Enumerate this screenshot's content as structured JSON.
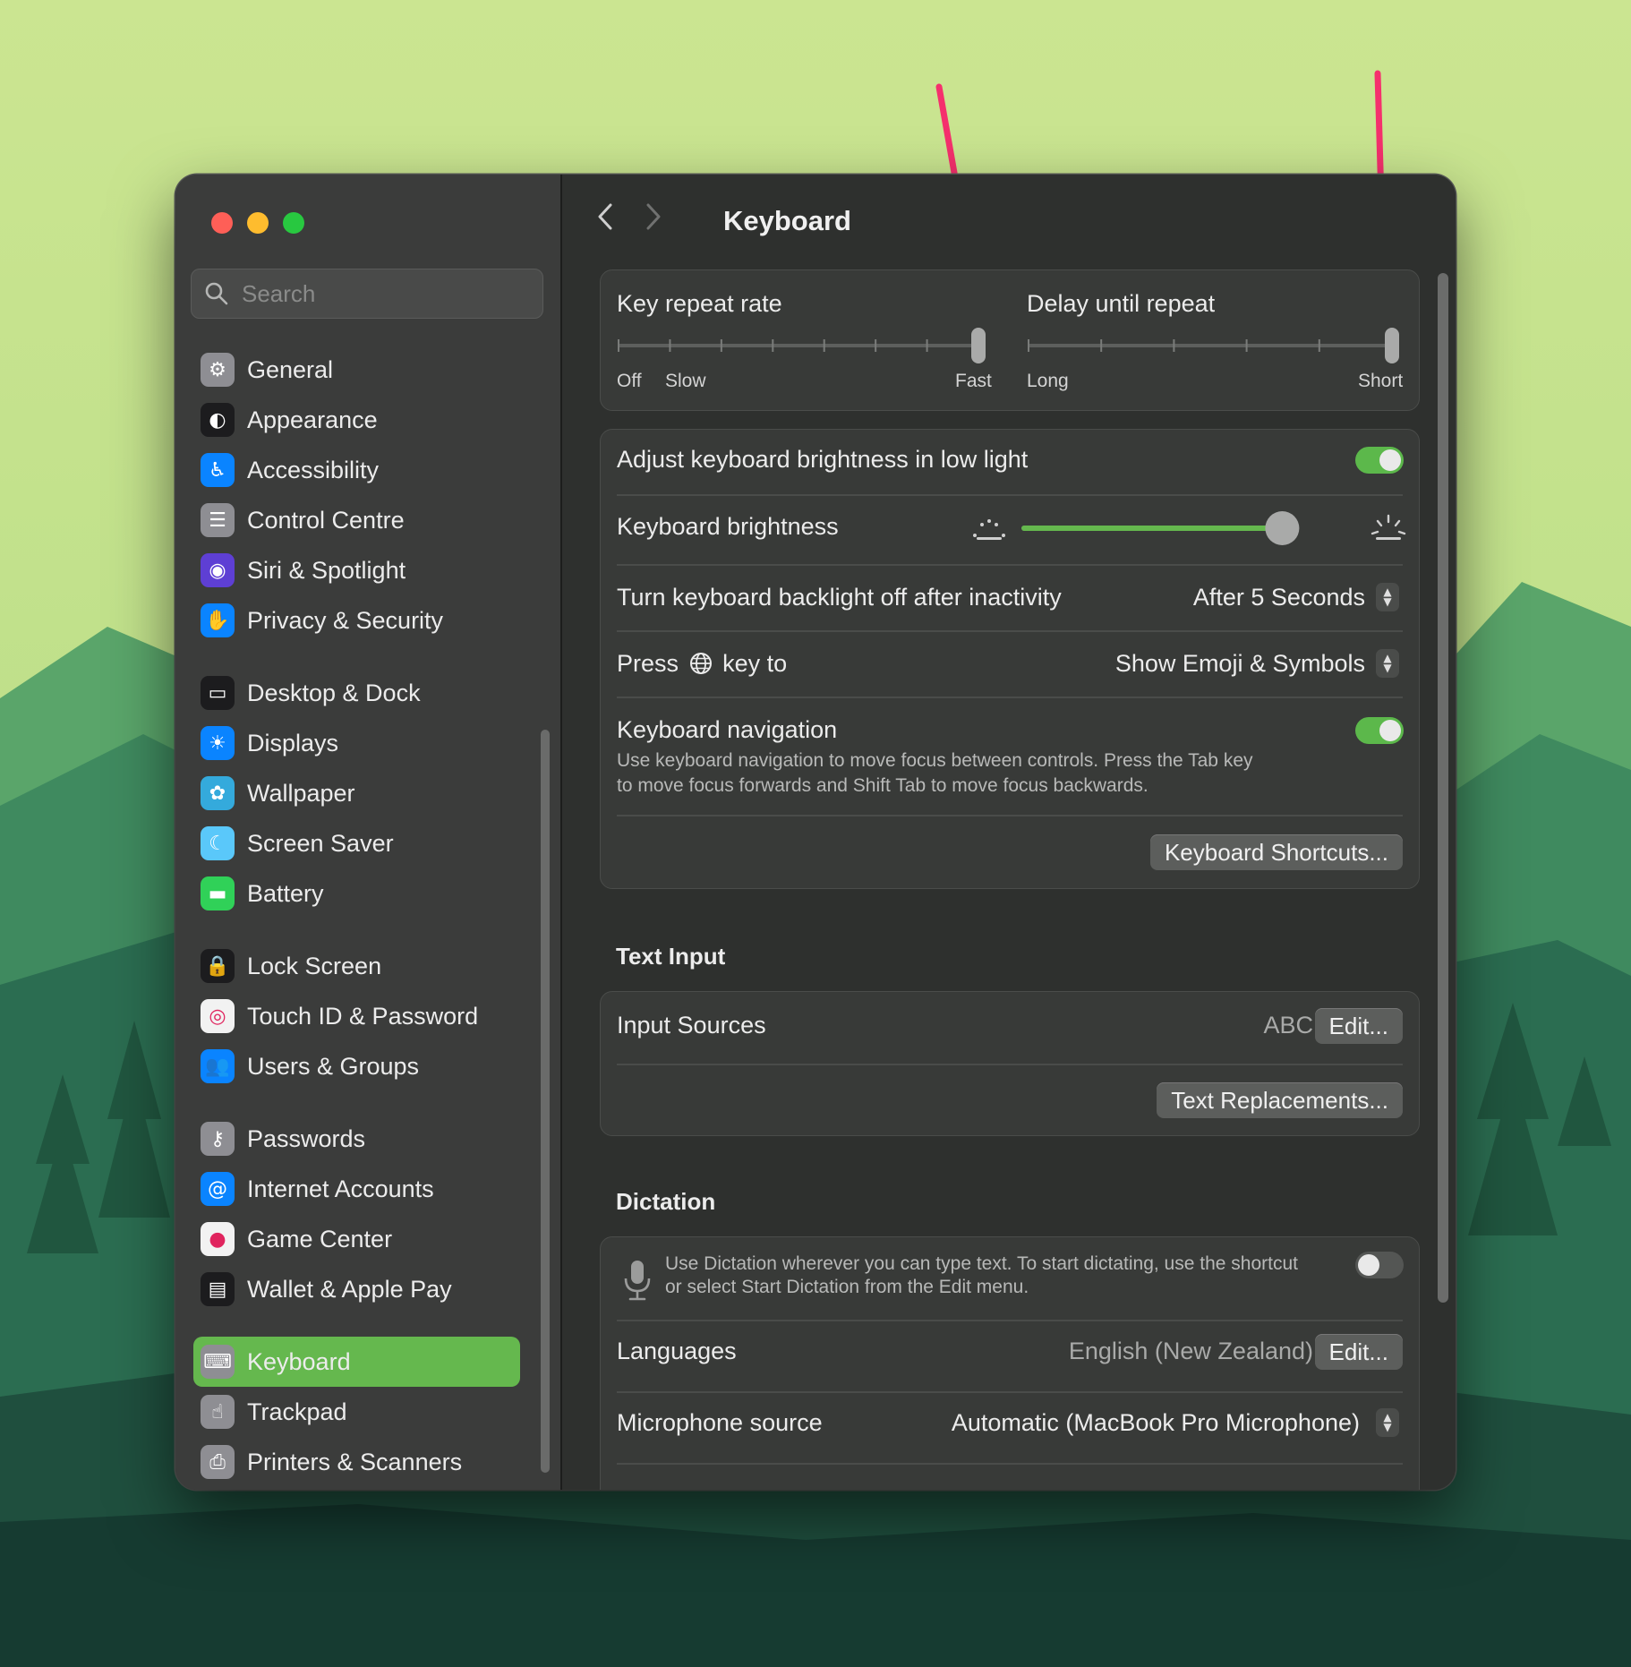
{
  "window": {
    "search_placeholder": "Search",
    "title": "Keyboard"
  },
  "sidebar": {
    "items": [
      {
        "label": "General",
        "icon": "gear-icon",
        "color": "#8e8e93"
      },
      {
        "label": "Appearance",
        "icon": "appearance-icon",
        "color": "#1c1c1e"
      },
      {
        "label": "Accessibility",
        "icon": "accessibility-icon",
        "color": "#0a84ff"
      },
      {
        "label": "Control Centre",
        "icon": "control-centre-icon",
        "color": "#8e8e93"
      },
      {
        "label": "Siri & Spotlight",
        "icon": "siri-icon",
        "color": "#5e3fd4"
      },
      {
        "label": "Privacy & Security",
        "icon": "hand-icon",
        "color": "#0a84ff"
      },
      {
        "label": "Desktop & Dock",
        "icon": "dock-icon",
        "color": "#1c1c1e"
      },
      {
        "label": "Displays",
        "icon": "sun-icon",
        "color": "#0a84ff"
      },
      {
        "label": "Wallpaper",
        "icon": "wallpaper-icon",
        "color": "#34aadc"
      },
      {
        "label": "Screen Saver",
        "icon": "screen-saver-icon",
        "color": "#5ac8fa"
      },
      {
        "label": "Battery",
        "icon": "battery-icon",
        "color": "#30d158"
      },
      {
        "label": "Lock Screen",
        "icon": "lock-icon",
        "color": "#1c1c1e"
      },
      {
        "label": "Touch ID & Password",
        "icon": "fingerprint-icon",
        "color": "#f2f2f2"
      },
      {
        "label": "Users & Groups",
        "icon": "users-icon",
        "color": "#0a84ff"
      },
      {
        "label": "Passwords",
        "icon": "key-icon",
        "color": "#8e8e93"
      },
      {
        "label": "Internet Accounts",
        "icon": "at-icon",
        "color": "#0a84ff"
      },
      {
        "label": "Game Center",
        "icon": "game-center-icon",
        "color": "#f2f2f2"
      },
      {
        "label": "Wallet & Apple Pay",
        "icon": "wallet-icon",
        "color": "#1c1c1e"
      },
      {
        "label": "Keyboard",
        "icon": "keyboard-icon",
        "color": "#8e8e93",
        "active": true
      },
      {
        "label": "Trackpad",
        "icon": "trackpad-icon",
        "color": "#8e8e93"
      },
      {
        "label": "Printers & Scanners",
        "icon": "printer-icon",
        "color": "#8e8e93"
      }
    ]
  },
  "repeat": {
    "rate_label": "Key repeat rate",
    "rate_min": "Off",
    "rate_slow": "Slow",
    "rate_max": "Fast",
    "rate_value": 1.0,
    "delay_label": "Delay until repeat",
    "delay_min": "Long",
    "delay_max": "Short",
    "delay_value": 1.0
  },
  "settings": {
    "adjust_brightness_label": "Adjust keyboard brightness in low light",
    "adjust_brightness_on": true,
    "brightness_label": "Keyboard brightness",
    "brightness_value": 0.94,
    "backlight_off_label": "Turn keyboard backlight off after inactivity",
    "backlight_off_value": "After 5 Seconds",
    "press_key_prefix": "Press",
    "press_key_suffix": "key to",
    "press_key_value": "Show Emoji & Symbols",
    "nav_label": "Keyboard navigation",
    "nav_desc_1": "Use keyboard navigation to move focus between controls. Press the Tab key",
    "nav_desc_2": "to move focus forwards and Shift Tab to move focus backwards.",
    "nav_on": true,
    "shortcuts_button": "Keyboard Shortcuts..."
  },
  "text_input": {
    "section": "Text Input",
    "sources_label": "Input Sources",
    "sources_value": "ABC",
    "edit_button": "Edit...",
    "replacements_button": "Text Replacements..."
  },
  "dictation": {
    "section": "Dictation",
    "desc_1": "Use Dictation wherever you can type text. To start dictating, use the shortcut",
    "desc_2": "or select Start Dictation from the Edit menu.",
    "enabled": false,
    "languages_label": "Languages",
    "languages_value": "English (New Zealand)",
    "edit_button": "Edit...",
    "mic_label": "Microphone source",
    "mic_value": "Automatic (MacBook Pro Microphone)"
  },
  "colors": {
    "accent": "#65b84e",
    "annotation_arrow": "#f5306d"
  }
}
